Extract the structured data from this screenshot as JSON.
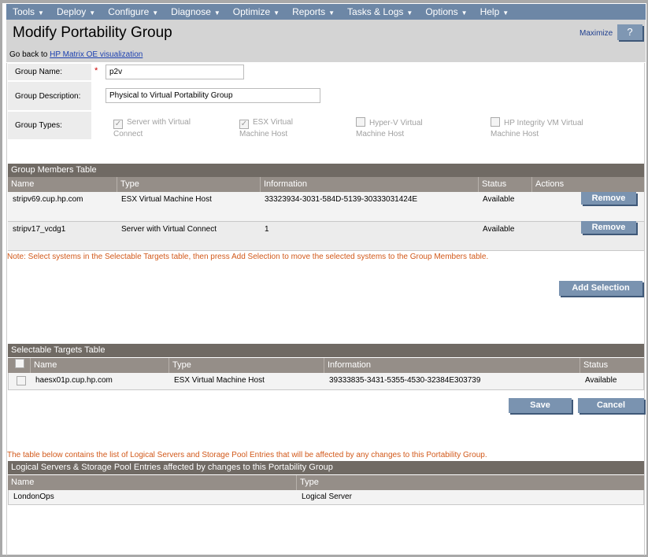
{
  "menu": [
    "Tools",
    "Deploy",
    "Configure",
    "Diagnose",
    "Optimize",
    "Reports",
    "Tasks & Logs",
    "Options",
    "Help"
  ],
  "header": {
    "title": "Modify Portability Group",
    "maximize": "Maximize",
    "help": "?",
    "goback_prefix": "Go back to",
    "goback_link": "HP Matrix OE visualization"
  },
  "form": {
    "name_label": "Group Name:",
    "required": "*",
    "name_value": "p2v",
    "desc_label": "Group Description:",
    "desc_value": "Physical to Virtual Portability Group",
    "types_label": "Group Types:",
    "types": [
      {
        "label": "Server with Virtual Connect",
        "checked": true
      },
      {
        "label": "ESX Virtual Machine Host",
        "checked": true
      },
      {
        "label": "Hyper-V Virtual Machine Host",
        "checked": false
      },
      {
        "label": "HP Integrity VM Virtual Machine Host",
        "checked": false
      }
    ]
  },
  "members": {
    "title": "Group Members Table",
    "columns": [
      "Name",
      "Type",
      "Information",
      "Status",
      "Actions"
    ],
    "rows": [
      {
        "name": "stripv69.cup.hp.com",
        "type": "ESX Virtual Machine Host",
        "info": "33323934-3031-584D-5139-30333031424E",
        "status": "Available",
        "action": "Remove"
      },
      {
        "name": "stripv17_vcdg1",
        "type": "Server with Virtual Connect",
        "info": "1",
        "status": "Available",
        "action": "Remove"
      }
    ]
  },
  "note1": "Note: Select systems in the Selectable Targets table, then press Add Selection to move the selected systems to the Group Members table.",
  "add_selection": "Add Selection",
  "targets": {
    "title": "Selectable Targets Table",
    "columns": [
      "Name",
      "Type",
      "Information",
      "Status"
    ],
    "rows": [
      {
        "name": "haesx01p.cup.hp.com",
        "type": "ESX Virtual Machine Host",
        "info": "39333835-3431-5355-4530-32384E303739",
        "status": "Available"
      }
    ]
  },
  "save": "Save",
  "cancel": "Cancel",
  "note2": "The table below contains the list of Logical Servers and Storage Pool Entries that will be affected by any changes to this Portability Group.",
  "affected": {
    "title": "Logical Servers & Storage Pool Entries affected by changes to this Portability Group",
    "columns": [
      "Name",
      "Type"
    ],
    "rows": [
      {
        "name": "LondonOps",
        "type": "Logical Server"
      }
    ]
  }
}
